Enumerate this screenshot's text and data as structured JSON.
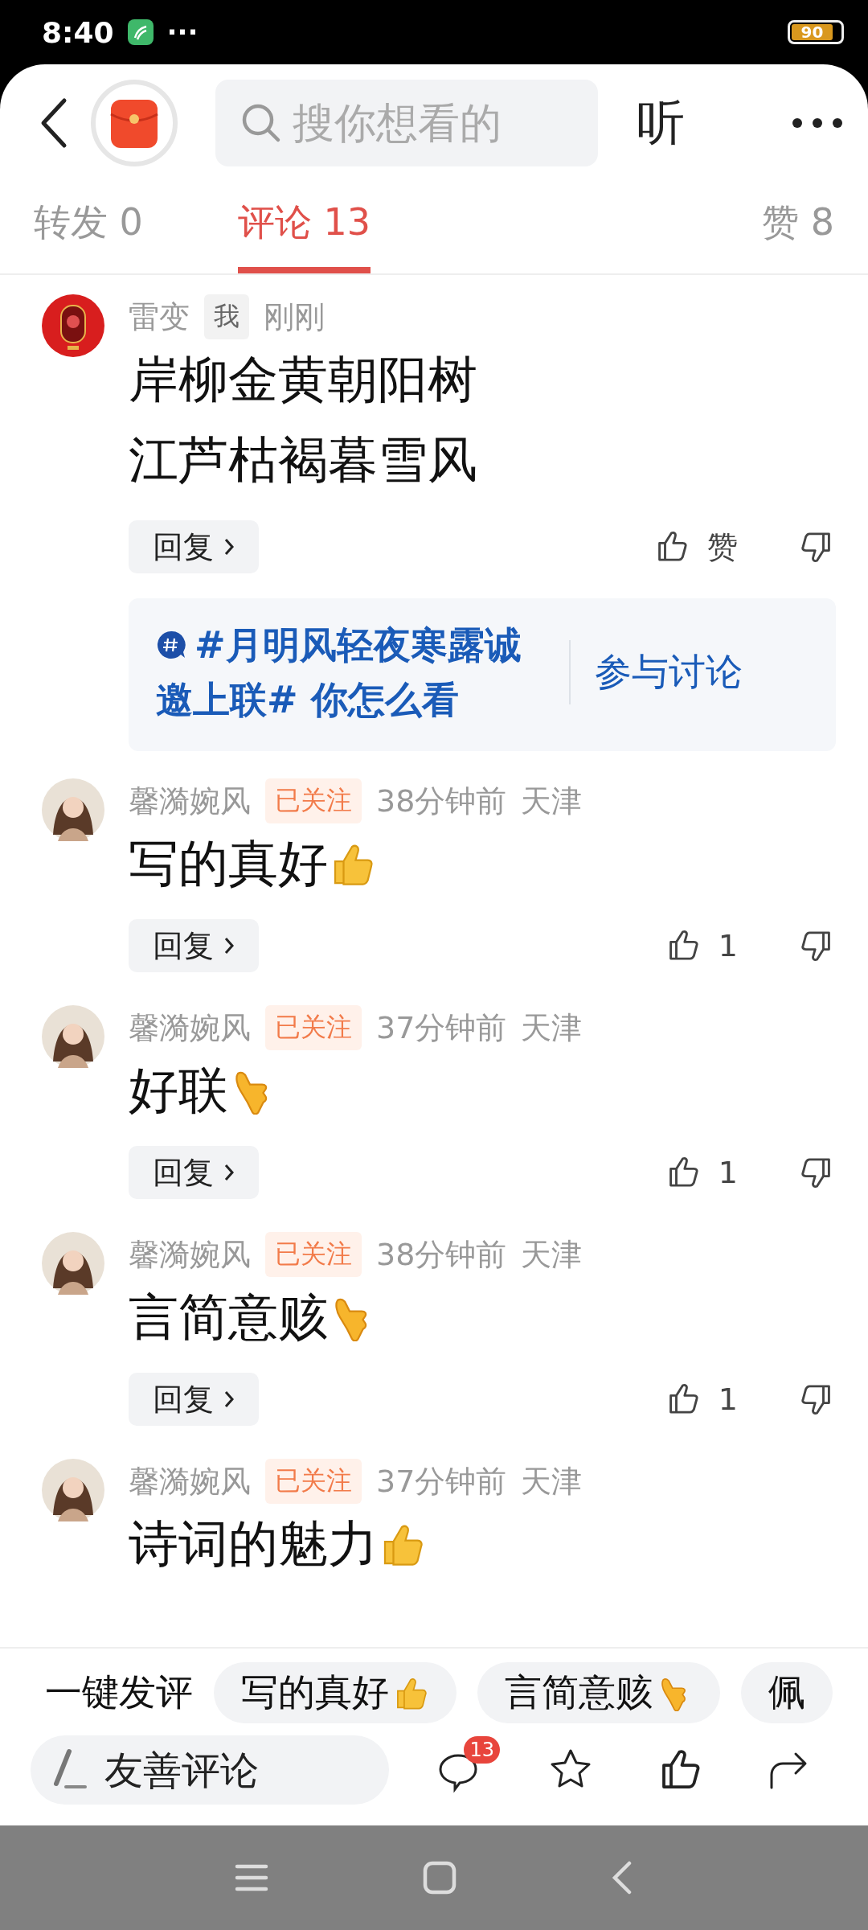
{
  "status_bar": {
    "time": "8:40",
    "more": "···",
    "battery": "90"
  },
  "header": {
    "search": {
      "placeholder": "搜你想看的"
    },
    "listen": "听"
  },
  "tabs": [
    {
      "label": "转发 0",
      "selected": false
    },
    {
      "label": "评论 13",
      "selected": true
    },
    {
      "label": "赞 8",
      "selected": false
    }
  ],
  "comments": [
    {
      "avatar": {
        "kind": "emblem"
      },
      "author": "雷变",
      "tag": {
        "kind": "self",
        "label": "我"
      },
      "time": "刚刚",
      "lines": [
        "岸柳金黄朝阳树",
        "江芦枯褐暮雪风"
      ],
      "reply": "回复",
      "likes": "赞",
      "topic": {
        "text": "#月明风轻夜寒露诚邀上联# 你怎么看",
        "action": "参与讨论"
      }
    },
    {
      "avatar": {
        "kind": "person"
      },
      "author": "馨漪婉风",
      "tag": {
        "kind": "following",
        "label": "已关注"
      },
      "time": "38分钟前",
      "location": "天津",
      "lines": [
        "写的真好"
      ],
      "emoji": {
        "kind": "thumbs_up"
      },
      "reply": "回复",
      "likes": "1"
    },
    {
      "avatar": {
        "kind": "person"
      },
      "author": "馨漪婉风",
      "tag": {
        "kind": "following",
        "label": "已关注"
      },
      "time": "37分钟前",
      "location": "天津",
      "lines": [
        "好联"
      ],
      "emoji": {
        "kind": "call_me"
      },
      "reply": "回复",
      "likes": "1"
    },
    {
      "avatar": {
        "kind": "person"
      },
      "author": "馨漪婉风",
      "tag": {
        "kind": "following",
        "label": "已关注"
      },
      "time": "38分钟前",
      "location": "天津",
      "lines": [
        "言简意赅"
      ],
      "emoji": {
        "kind": "call_me"
      },
      "reply": "回复",
      "likes": "1"
    },
    {
      "avatar": {
        "kind": "person"
      },
      "author": "馨漪婉风",
      "tag": {
        "kind": "following",
        "label": "已关注"
      },
      "time": "37分钟前",
      "location": "天津",
      "lines": [
        "诗词的魅力"
      ],
      "emoji": {
        "kind": "thumbs_up"
      }
    }
  ],
  "quick_comments": {
    "label": "一键发评",
    "chips": [
      {
        "text": "写的真好",
        "emoji": {
          "kind": "thumbs_up"
        }
      },
      {
        "text": "言简意赅",
        "emoji": {
          "kind": "call_me"
        }
      },
      {
        "text": "佩"
      }
    ]
  },
  "composer": {
    "placeholder": "友善评论",
    "comment_count": "13"
  }
}
